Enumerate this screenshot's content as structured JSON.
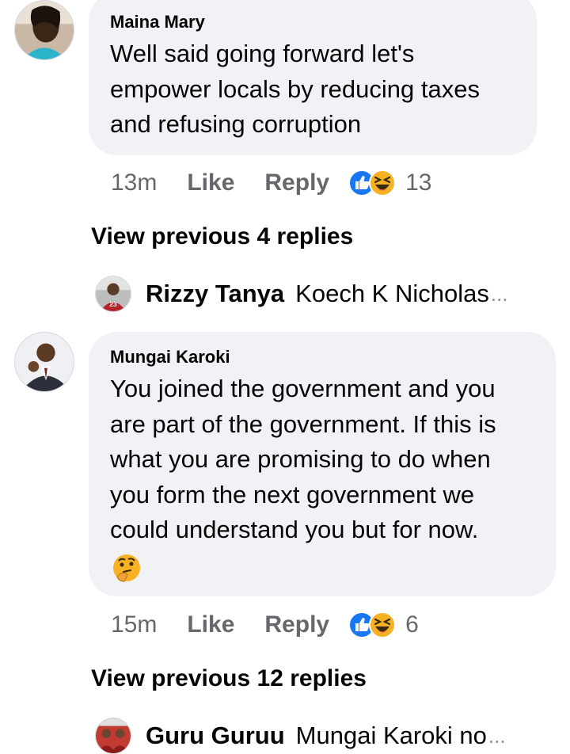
{
  "comments": [
    {
      "author": "Maina Mary",
      "text_lines": [
        "Well said going forward let's",
        "empower locals by reducing taxes",
        "and refusing corruption"
      ],
      "time": "13m",
      "like_label": "Like",
      "reply_label": "Reply",
      "reaction_icons": [
        "like-icon",
        "haha-icon"
      ],
      "reaction_count": "13",
      "view_previous": "View previous 4 replies",
      "latest_reply": {
        "author": "Rizzy Tanya",
        "snippet": "Koech K Nicholas",
        "ellipsis": "..."
      }
    },
    {
      "author": "Mungai Karoki",
      "text_lines": [
        "You joined the government and you",
        "are part of the government. If this is",
        "what you are promising to do when",
        "you form the next government we",
        "could understand you but for now."
      ],
      "emoji": "thinking-face-icon",
      "time": "15m",
      "like_label": "Like",
      "reply_label": "Reply",
      "reaction_icons": [
        "like-icon",
        "haha-icon"
      ],
      "reaction_count": "6",
      "view_previous": "View previous 12 replies",
      "latest_reply": {
        "author": "Guru Guruu",
        "snippet": "Mungai Karoki no",
        "ellipsis": "..."
      }
    }
  ],
  "colors": {
    "bubble": "#f0f2f5",
    "meta_gray": "#65676b",
    "like_blue": "#1877f2",
    "haha_yellow": "#f7b125"
  }
}
